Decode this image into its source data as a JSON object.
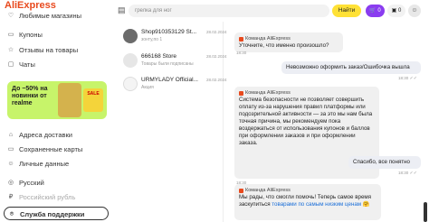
{
  "app": {
    "logo": "AliExpress"
  },
  "sidebar": {
    "items_top": [
      {
        "label": "Любимые магазины",
        "icon": "heart-store-icon"
      },
      {
        "label": "Купоны",
        "icon": "coupon-icon"
      },
      {
        "label": "Отзывы на товары",
        "icon": "review-icon"
      },
      {
        "label": "Чаты",
        "icon": "chat-icon"
      }
    ],
    "promo": {
      "text": "До −50% на новинки от realme",
      "tag": "SALE"
    },
    "items_bottom": [
      {
        "label": "Адреса доставки",
        "icon": "location-icon"
      },
      {
        "label": "Сохраненные карты",
        "icon": "card-icon"
      },
      {
        "label": "Личные данные",
        "icon": "profile-icon"
      },
      {
        "label": "Русский",
        "icon": "globe-icon"
      },
      {
        "label": "Российский рубль",
        "icon": "ruble-icon"
      },
      {
        "label": "Служба поддержки",
        "icon": "support-icon"
      }
    ]
  },
  "header": {
    "search_placeholder": "грелка для ног",
    "find_label": "Найти",
    "cart_count": "0",
    "user_label": "0"
  },
  "chats": [
    {
      "name": "Shop910353129 St...",
      "date": "28.02.2024",
      "preview": "зонту,по 1"
    },
    {
      "name": "666168 Store",
      "date": "28.02.2024",
      "preview": "Товары были подписаны"
    },
    {
      "name": "URMYLADY Official...",
      "date": "28.02.2024",
      "preview": "Акция"
    }
  ],
  "messages": [
    {
      "sender": "Команда AliExpress",
      "text": "Уточните, что именно произошло?",
      "time": "18:30"
    },
    {
      "text": "Невозможно оформить заказ/Ошибочка вышла",
      "time": "18:30"
    },
    {
      "sender": "Команда AliExpress",
      "text": "Система безопасности не позволяет совершить оплату из-за нарушения правил платформы или подозрительной активности — за это мы нам была точная причина, мы рекомендуем пока воздержаться от использования купонов и баллов при оформлении заказов и при оформлении заказа.",
      "time": "18:30"
    },
    {
      "text": "Спасибо, все понятно",
      "time": "18:30"
    },
    {
      "sender": "Команда AliExpress",
      "text_a": "Мы рады, что смогли помочь! Теперь самое время заскупиться ",
      "link": "товарами по самым низким ценам",
      "emoji": "🤗",
      "time": ""
    }
  ],
  "colors": {
    "accent": "#e8491d",
    "find": "#ffe136",
    "cart": "#8a3cf0",
    "promo": "#c7f46a"
  }
}
